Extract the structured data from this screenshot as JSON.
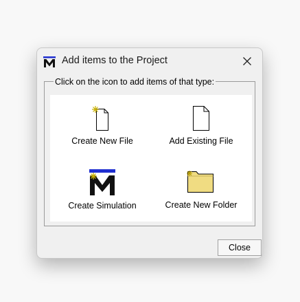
{
  "dialog": {
    "title": "Add items to the Project",
    "close_icon": "close-icon",
    "logo_icon": "app-logo-icon",
    "legend": "Click on the icon to add items of that type:",
    "items": [
      {
        "label": "Create New File",
        "icon": "new-file-icon"
      },
      {
        "label": "Add Existing File",
        "icon": "file-icon"
      },
      {
        "label": "Create Simulation",
        "icon": "simulation-icon"
      },
      {
        "label": "Create New Folder",
        "icon": "new-folder-icon"
      }
    ],
    "close_label": "Close"
  },
  "colors": {
    "logo_bar": "#1f2fd0",
    "spark": "#c8b000",
    "folder": "#f0dc82"
  }
}
